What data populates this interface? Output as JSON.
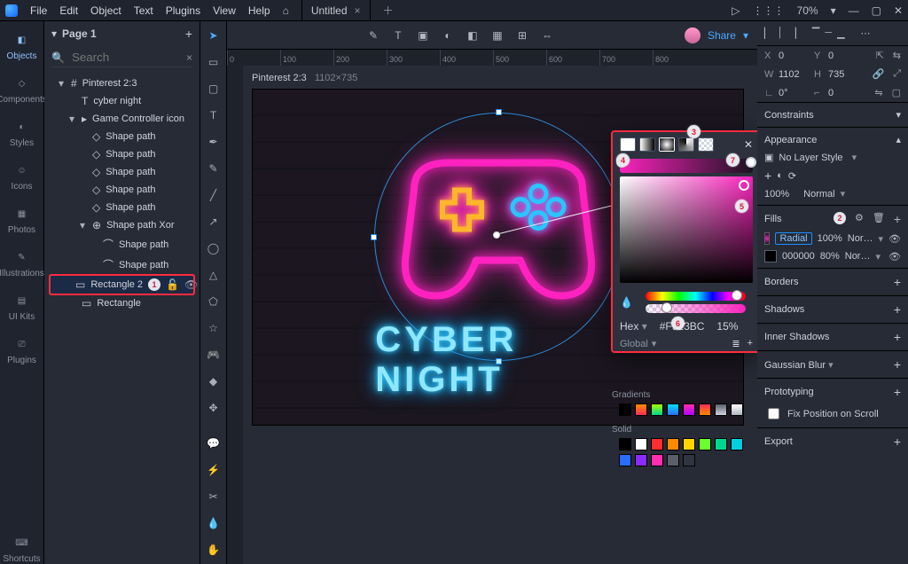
{
  "menu": {
    "file": "File",
    "edit": "Edit",
    "object": "Object",
    "text": "Text",
    "plugins": "Plugins",
    "view": "View",
    "help": "Help"
  },
  "document": {
    "title": "Untitled"
  },
  "titlebar": {
    "zoom": "70%",
    "share": "Share"
  },
  "rail": {
    "objects": "Objects",
    "components": "Components",
    "styles": "Styles",
    "icons": "Icons",
    "photos": "Photos",
    "illustrations": "Illustrations",
    "uikits": "UI Kits",
    "plugins": "Plugins",
    "shortcuts": "Shortcuts"
  },
  "layers": {
    "page": "Page 1",
    "search_placeholder": "Search",
    "frame": "Pinterest 2:3",
    "cyber_night": "cyber night",
    "controller": "Game Controller icon",
    "shape_path": "Shape path",
    "shape_xor": "Shape path Xor",
    "rect2": "Rectangle 2",
    "rect": "Rectangle"
  },
  "artboard": {
    "label": "Pinterest 2:3",
    "dims": "1102×735",
    "text": "CYBER NIGHT"
  },
  "ruler": {
    "t0": "0",
    "t1": "100",
    "t2": "200",
    "t3": "300",
    "t4": "400",
    "t5": "500",
    "t6": "600",
    "t7": "700",
    "t8": "800"
  },
  "color_popover": {
    "hex_label": "Hex",
    "hex": "#F923BC",
    "opacity": "15%",
    "global": "Global",
    "gradients": "Gradients",
    "solid": "Solid"
  },
  "swatches": {
    "gradients": [
      "#000000",
      "linear-gradient(#ff8a00,#ff2d55)",
      "linear-gradient(#a6ff00,#00d68f)",
      "linear-gradient(#00e0ff,#2b6bff)",
      "linear-gradient(#ff2daf,#b300ff)",
      "linear-gradient(#ff2d55,#ff8a00)",
      "linear-gradient(#5a5f6a,#cfd4dd)",
      "linear-gradient(#ffffff,#b0b6c2)"
    ],
    "solid": [
      "#000000",
      "#ffffff",
      "#ff2d2d",
      "#ff8a00",
      "#ffd400",
      "#6bff2d",
      "#00d68f",
      "#00cfe0",
      "#2b6bff",
      "#8a2bff",
      "#ff2daf",
      "#5a5f6a",
      "#2f3541"
    ]
  },
  "inspector": {
    "x_lbl": "X",
    "x": "0",
    "y_lbl": "Y",
    "y": "0",
    "w_lbl": "W",
    "w": "1102",
    "h_lbl": "H",
    "h": "735",
    "angle_lbl": "∟",
    "angle": "0°",
    "corner_lbl": "⌐",
    "corner": "0",
    "constraints": "Constraints",
    "appearance": "Appearance",
    "no_layer_style": "No Layer Style",
    "opacity": "100%",
    "blend": "Normal",
    "fills": "Fills",
    "fill_type_1": "Radial",
    "fill_op_1": "100%",
    "fill_blend_1": "Nor…",
    "fill_hex_2": "000000",
    "fill_op_2": "80%",
    "fill_blend_2": "Nor…",
    "borders": "Borders",
    "shadows": "Shadows",
    "inner_shadows": "Inner Shadows",
    "blur": "Gaussian Blur",
    "proto": "Prototyping",
    "fix_scroll": "Fix Position on Scroll",
    "export": "Export"
  },
  "callouts": {
    "c1": "1",
    "c2": "2",
    "c3": "3",
    "c4": "4",
    "c5": "5",
    "c6": "6",
    "c7": "7"
  }
}
